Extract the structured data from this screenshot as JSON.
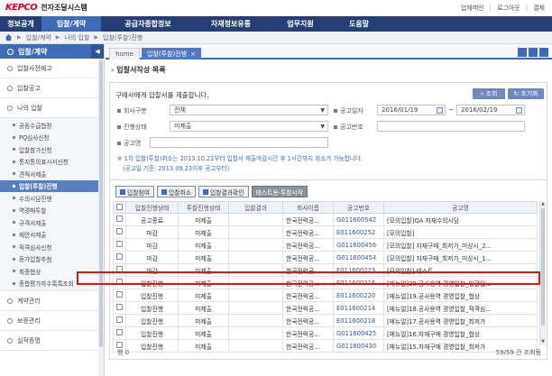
{
  "header": {
    "logo_text": "KEPCO",
    "system_name": "전자조달시스템",
    "links": [
      "업체메인",
      "로그아웃",
      "결제"
    ]
  },
  "mainnav": [
    {
      "label": "정보공개",
      "active": false
    },
    {
      "label": "입찰/계약",
      "active": true
    },
    {
      "label": "공급자종합정보",
      "active": false
    },
    {
      "label": "자재정보유통",
      "active": false
    },
    {
      "label": "업무지원",
      "active": false
    },
    {
      "label": "도움말",
      "active": false
    }
  ],
  "breadcrumb": [
    "입찰/계약",
    "나의 입찰",
    "입찰(투찰)진행"
  ],
  "sidebar": {
    "title": "입찰/계약",
    "items": [
      {
        "label": "입찰사전예고"
      },
      {
        "label": "입찰공고"
      },
      {
        "label": "나의 입찰"
      }
    ],
    "subitems": [
      {
        "label": "공동수급협정",
        "active": false
      },
      {
        "label": "PQ심사신청",
        "active": false
      },
      {
        "label": "입찰참가신청",
        "active": false
      },
      {
        "label": "통지통의표시서신청",
        "active": false
      },
      {
        "label": "견적서제출",
        "active": false
      },
      {
        "label": "입찰(투찰)진행",
        "active": true
      },
      {
        "label": "수의시담진행",
        "active": false
      },
      {
        "label": "역경매투찰",
        "active": false
      },
      {
        "label": "규격서제출",
        "active": false
      },
      {
        "label": "제안서제출",
        "active": false
      },
      {
        "label": "적격심사신청",
        "active": false
      },
      {
        "label": "동가입찰추첨",
        "active": false
      },
      {
        "label": "최종협상",
        "active": false
      },
      {
        "label": "종합평가자수록록조회",
        "active": false
      }
    ],
    "bottom_items": [
      {
        "label": "계약관리"
      },
      {
        "label": "보증관리"
      },
      {
        "label": "실적증명"
      }
    ]
  },
  "tabs": [
    {
      "label": "home",
      "active": false
    },
    {
      "label": "입찰(투찰)진행",
      "active": true
    }
  ],
  "page_title": "입찰서작성 목록",
  "search": {
    "notice": "구매사에게 입찰서를 제출합니다.",
    "search_button": "조회",
    "reset_button": "초기화",
    "company_label": "회사구분",
    "company_value": "전체",
    "date_label": "공고일자",
    "date_from": "2016/01/19",
    "date_to": "2016/02/19",
    "status_label": "진행상태",
    "status_value": "미제출",
    "number_label": "공고번호",
    "number_value": "",
    "name_label": "공고명",
    "name_value": "",
    "note1": "※ 1차 입찰(투찰)취소는 2013.10.21부터 입찰서 제출마감시간 후 1시간까지 취소가 가능합니다.",
    "note2": "(공고일 기준: 2013.09.23이후 공고부터)"
  },
  "table": {
    "toolbar": [
      "입찰참여",
      "입찰취소",
      "입찰결과확인",
      "테스트용-투찰시작"
    ],
    "columns": [
      "",
      "입찰진행상태",
      "투찰진행상태",
      "입찰결과",
      "회사이름",
      "공고번호",
      "공고명"
    ],
    "rows": [
      {
        "state": "공고종료",
        "bid": "미제출",
        "result": "",
        "company": "한국전력공...",
        "number": "G011600542",
        "name": "[모의입찰]QA 자재수의시담"
      },
      {
        "state": "마감",
        "bid": "미제출",
        "result": "",
        "company": "한국전력공...",
        "number": "E011600252",
        "name": "[모의입찰]"
      },
      {
        "state": "마감",
        "bid": "미제출",
        "result": "",
        "company": "한국전력공...",
        "number": "G011600456",
        "name": "[모의입찰] 자재구매_최저가_미상시_2..."
      },
      {
        "state": "마감",
        "bid": "미제출",
        "result": "",
        "company": "한국전력공...",
        "number": "G011600454",
        "name": "[모의입찰] 자재구매_최저가_미상시_1..."
      },
      {
        "state": "마감",
        "bid": "미제출",
        "result": "",
        "company": "한국전력공...",
        "number": "E011600223",
        "name": "[모의입찰] 테스트"
      },
      {
        "state": "입찰진행",
        "bid": "미제출",
        "result": "",
        "company": "한국전력공...",
        "number": "E011600216",
        "name": "[매뉴얼]20.공사용역 경영입찰_일괄입..."
      },
      {
        "state": "입찰진행",
        "bid": "미제출",
        "result": "",
        "company": "한국전력공...",
        "number": "E011600220",
        "name": "[매뉴얼]19.공사용역 경영입찰_협상"
      },
      {
        "state": "입찰진행",
        "bid": "미제출",
        "result": "",
        "company": "한국전력공...",
        "number": "E011600214",
        "name": "[매뉴얼]18.공사용역 경영입찰_적격심..."
      },
      {
        "state": "입찰진행",
        "bid": "미제출",
        "result": "",
        "company": "한국전력공...",
        "number": "E011600218",
        "name": "[매뉴얼]17.공사용역 경영입찰_최저가"
      },
      {
        "state": "입찰진행",
        "bid": "미제출",
        "result": "",
        "company": "한국전력공...",
        "number": "G011600425",
        "name": "[매뉴얼]16.자재구매 경영입찰_협상"
      },
      {
        "state": "입찰진행",
        "bid": "미제출",
        "result": "",
        "company": "한국전력공...",
        "number": "G011600430",
        "name": "[매뉴얼]15.자재구매 경영입찰_최저가"
      }
    ]
  },
  "footer": {
    "rows_label": "행 0",
    "count_text": "59/59 건 조회됨"
  },
  "colors": {
    "nav_bg": "#243f78",
    "accent": "#3e6bb8",
    "highlight_border": "#e01414"
  }
}
